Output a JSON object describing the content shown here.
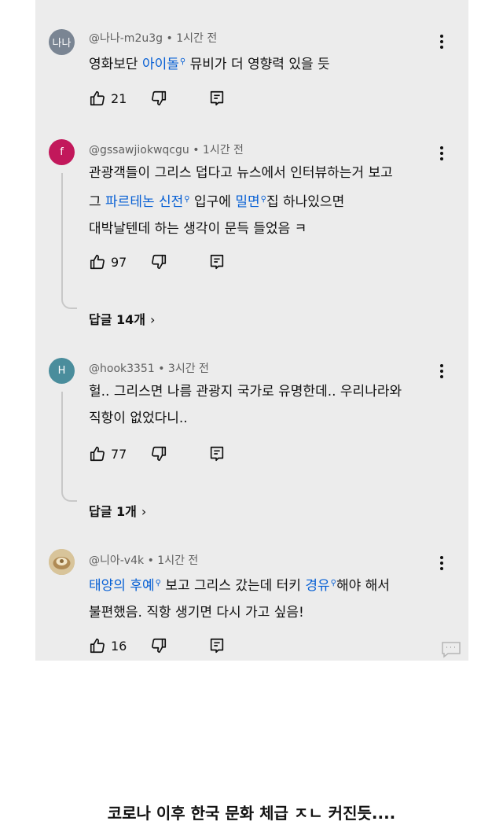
{
  "comments": [
    {
      "avatar_text": "나나",
      "avatar_color": "#7a8593",
      "handle": "@나나-m2u3g",
      "time": "1시간 전",
      "lines": [
        [
          {
            "t": "영화보단 "
          },
          {
            "t": "아이돌",
            "link": true
          },
          {
            "t": " 뮤비가 더 영향력 있을 듯"
          }
        ]
      ],
      "likes": "21"
    },
    {
      "avatar_text": "f",
      "avatar_color": "#c2185b",
      "handle": "@gssawjiokwqcgu",
      "time": "1시간 전",
      "lines": [
        [
          {
            "t": "관광객들이 그리스 덥다고 뉴스에서 인터뷰하는거 보고"
          }
        ],
        [
          {
            "t": "그 "
          },
          {
            "t": "파르테논 신전",
            "link": true
          },
          {
            "t": " 입구에 "
          },
          {
            "t": "밀면",
            "link": true
          },
          {
            "t": "집 하나있으면"
          }
        ],
        [
          {
            "t": "대박날텐데 하는 생각이 문득 들었음 ㅋ"
          }
        ]
      ],
      "likes": "97",
      "replies": "답글 14개"
    },
    {
      "avatar_text": "H",
      "avatar_color": "#4a8d9c",
      "handle": "@hook3351",
      "time": "3시간 전",
      "lines": [
        [
          {
            "t": "헐.. 그리스면 나름 관광지 국가로 유명한데.. 우리나라와"
          }
        ],
        [
          {
            "t": "직항이 없었다니.."
          }
        ]
      ],
      "likes": "77",
      "replies": "답글 1개"
    },
    {
      "avatar_text": "",
      "avatar_color": "#c9b48a",
      "handle": "@니아-v4k",
      "time": "1시간 전",
      "lines": [
        [
          {
            "t": "태양의 후예",
            "link": true
          },
          {
            "t": " 보고 그리스 갔는데 터키 "
          },
          {
            "t": "경유",
            "link": true
          },
          {
            "t": "해야 해서"
          }
        ],
        [
          {
            "t": "불편했음. 직항 생기면 다시 가고 싶음!"
          }
        ]
      ],
      "likes": "16"
    }
  ],
  "caption": "코로나 이후 한국 문화 체급 ㅈㄴ 커진듯....",
  "icons": {
    "search_mark": "search-icon",
    "like": "thumbs-up-icon",
    "dislike": "thumbs-down-icon",
    "reply": "reply-icon",
    "menu": "more-vertical-icon",
    "chevron": "chevron-right-icon",
    "chat": "chat-bubble-icon"
  }
}
